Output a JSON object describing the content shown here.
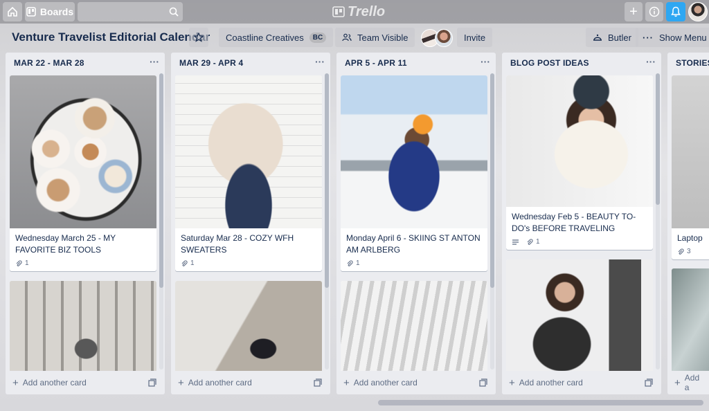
{
  "topbar": {
    "boards_label": "Boards",
    "logo_text": "Trello"
  },
  "board": {
    "title": "Venture Travelist Editorial Calendar",
    "team_name": "Coastline Creatives",
    "team_badge": "BC",
    "visibility": "Team Visible",
    "invite_label": "Invite",
    "butler_label": "Butler",
    "menu_label": "Show Menu"
  },
  "lists": [
    {
      "title": "MAR 22 - MAR 28",
      "cards": [
        {
          "title": "Wednesday March 25 - MY FAVORITE BIZ TOOLS",
          "attachments": "1"
        }
      ],
      "add_label": "Add another card"
    },
    {
      "title": "MAR 29 - APR 4",
      "cards": [
        {
          "title": "Saturday Mar 28 - COZY WFH SWEATERS",
          "attachments": "1"
        }
      ],
      "add_label": "Add another card"
    },
    {
      "title": "APR 5 - APR 11",
      "cards": [
        {
          "title": "Monday April 6 - SKIING ST ANTON AM ARLBERG",
          "attachments": "1"
        }
      ],
      "add_label": "Add another card"
    },
    {
      "title": "BLOG POST IDEAS",
      "cards": [
        {
          "title": "Wednesday Feb 5 - BEAUTY TO-DO's BEFORE TRAVELING",
          "attachments": "1"
        }
      ],
      "add_label": "Add another card"
    },
    {
      "title": "STORIES",
      "cards": [
        {
          "title": "Laptop",
          "attachments": "3"
        }
      ],
      "add_label": "Add a"
    }
  ],
  "colors": {
    "list_bg": "#ebecf0",
    "bell_accent": "#2ea7f2",
    "text": "#172b4d"
  }
}
